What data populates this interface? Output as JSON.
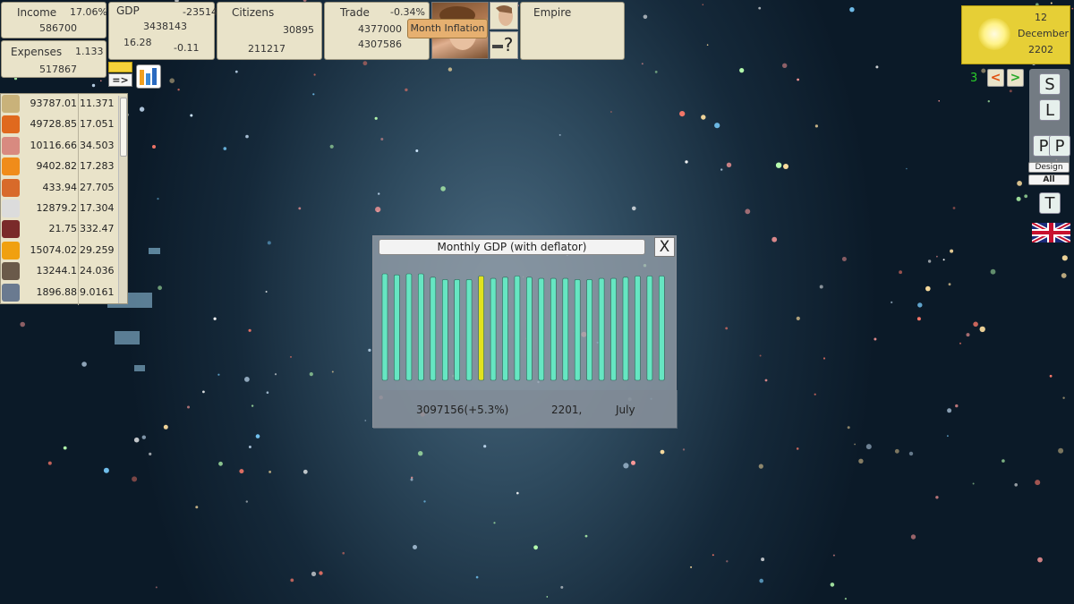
{
  "top_bar": {
    "income": {
      "label": "Income",
      "percent": "17.06%",
      "value": "586700"
    },
    "expenses": {
      "label": "Expenses",
      "ratio": "1.133",
      "value": "517867"
    },
    "gdp": {
      "label": "GDP",
      "change": "-23514",
      "value": "3438143",
      "sub_left": "16.28",
      "sub_right": "-0.11"
    },
    "citizens": {
      "label": "Citizens",
      "value1": "30895",
      "value2": "211217"
    },
    "trade": {
      "label": "Trade",
      "percent": "-0.34%",
      "value1": "4377000",
      "value2": "4307586"
    },
    "tooltip": "Month Inflation",
    "help_label": "?",
    "empire_label": "Empire",
    "arrow_label": "=>"
  },
  "resources": [
    {
      "icon": "wheat-icon",
      "amount": "93787.01",
      "rate": "11.371",
      "color": "#c9b27a"
    },
    {
      "icon": "orange-icon",
      "amount": "49728.85",
      "rate": "17.051",
      "color": "#e0691e"
    },
    {
      "icon": "meat-icon",
      "amount": "10116.66",
      "rate": "34.503",
      "color": "#d88a80"
    },
    {
      "icon": "citrus-icon",
      "amount": "9402.82",
      "rate": "17.283",
      "color": "#f08c1a"
    },
    {
      "icon": "fruit-icon",
      "amount": "433.94",
      "rate": "27.705",
      "color": "#d86a2a"
    },
    {
      "icon": "cotton-icon",
      "amount": "12879.2",
      "rate": "17.304",
      "color": "#dcdcdc"
    },
    {
      "icon": "gem-icon",
      "amount": "21.75",
      "rate": "332.47",
      "color": "#7a2a2a"
    },
    {
      "icon": "shirt-icon",
      "amount": "15074.02",
      "rate": "29.259",
      "color": "#f0a010"
    },
    {
      "icon": "bottle-icon",
      "amount": "13244.1",
      "rate": "24.036",
      "color": "#6a5a4a"
    },
    {
      "icon": "ore-icon",
      "amount": "1896.88",
      "rate": "9.0161",
      "color": "#6a7a90"
    }
  ],
  "dialog": {
    "title": "Monthly GDP (with deflator)",
    "close_label": "X",
    "footer_value": "3097156(+5.3%)",
    "footer_year": "2201,",
    "footer_month": "July"
  },
  "chart_data": {
    "type": "bar",
    "title": "Monthly GDP (with deflator)",
    "values": [
      0.93,
      0.92,
      0.93,
      0.93,
      0.9,
      0.88,
      0.88,
      0.88,
      0.91,
      0.89,
      0.9,
      0.91,
      0.9,
      0.89,
      0.89,
      0.89,
      0.88,
      0.88,
      0.89,
      0.89,
      0.9,
      0.91,
      0.91,
      0.91
    ],
    "highlight_index": 8,
    "ylim": [
      0,
      1
    ],
    "bar_color": "#66e6c2",
    "highlight_color": "#e2e21e"
  },
  "date": {
    "day": "12",
    "month": "December",
    "year": "2202"
  },
  "speed": {
    "value": "3",
    "prev": "<",
    "next": ">"
  },
  "side_buttons": {
    "s": "S",
    "l": "L",
    "p1": "P",
    "p2": "P",
    "design": "Design",
    "all": "All",
    "t": "T"
  },
  "colors": {
    "panel": "#e9e3c9",
    "date_panel": "#e6cf36",
    "speed_text": "#2acc2a"
  }
}
